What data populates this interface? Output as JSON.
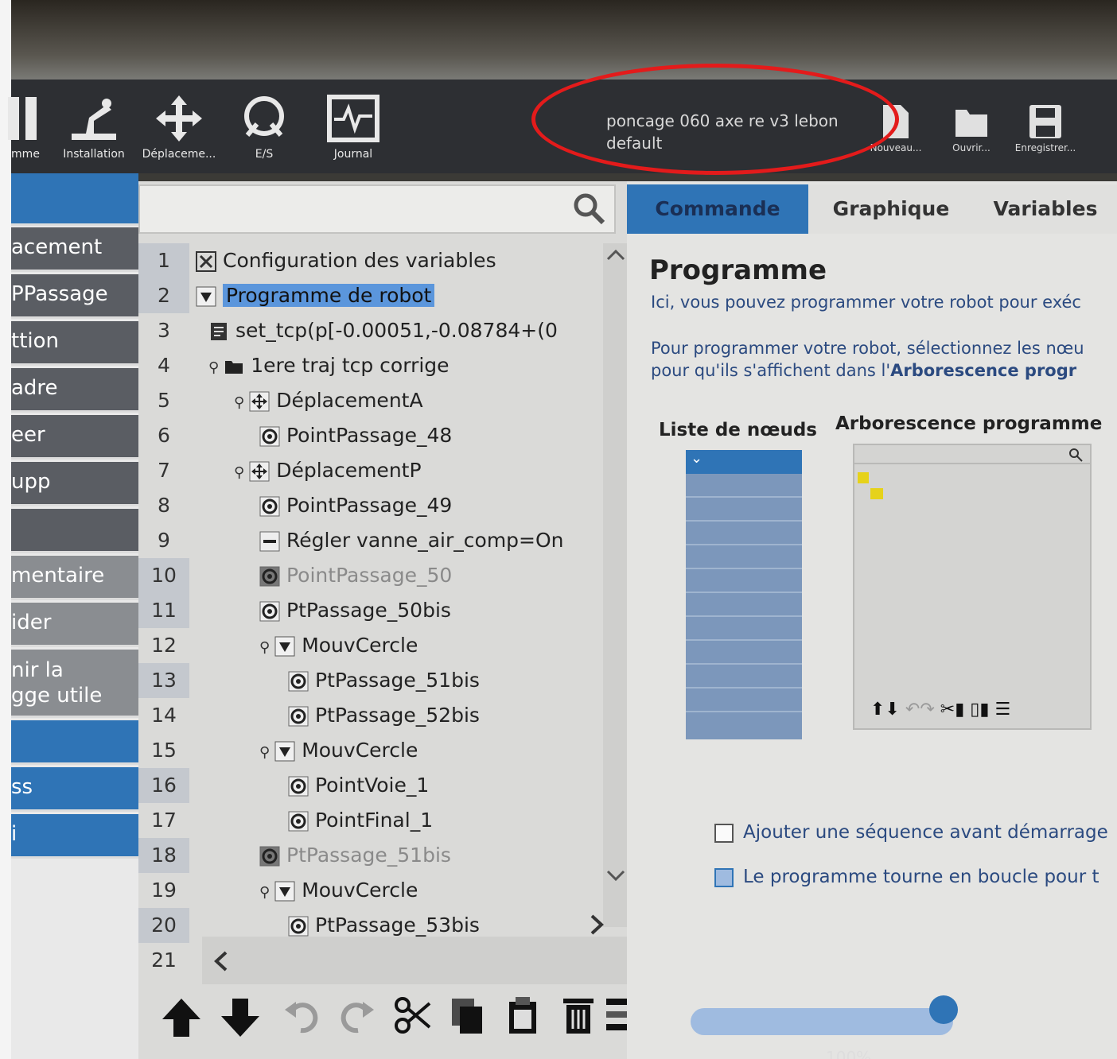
{
  "header": {
    "tools": [
      {
        "label": "mme",
        "icon": "program-icon"
      },
      {
        "label": "Installation",
        "icon": "robot-arm-icon"
      },
      {
        "label": "Déplaceme...",
        "icon": "move-arrows-icon"
      },
      {
        "label": "E/S",
        "icon": "io-icon"
      },
      {
        "label": "Journal",
        "icon": "log-icon"
      }
    ],
    "program_name": "poncage 060 axe re v3 lebon",
    "installation_name": "default",
    "file_buttons": [
      {
        "label": "Nouveau...",
        "icon": "new-file-icon"
      },
      {
        "label": "Ouvrir...",
        "icon": "open-folder-icon"
      },
      {
        "label": "Enregistrer...",
        "icon": "save-icon"
      }
    ]
  },
  "sidebar": {
    "items": [
      "acement",
      "PPassage",
      "ttion",
      "adre",
      "eer",
      "upp",
      "",
      "mentaire",
      "ider",
      "nir la",
      "gge utile",
      "",
      "ss",
      "i"
    ],
    "item_2_line": "gge utile"
  },
  "tree": {
    "line_numbers": [
      "1",
      "2",
      "3",
      "4",
      "5",
      "6",
      "7",
      "8",
      "9",
      "10",
      "11",
      "12",
      "13",
      "14",
      "15",
      "16",
      "17",
      "18",
      "19",
      "20",
      "21"
    ],
    "nodes": [
      {
        "text": "Configuration des variables",
        "icon": "variables-icon"
      },
      {
        "text": "Programme de robot",
        "icon": "collapse-icon"
      },
      {
        "text": "set_tcp(p[-0.00051,-0.08784+(0",
        "icon": "script-icon"
      },
      {
        "text": "1ere traj tcp corrige",
        "icon": "folder-icon"
      },
      {
        "text": "DéplacementA",
        "icon": "move-icon"
      },
      {
        "text": "PointPassage_48",
        "icon": "waypoint-icon"
      },
      {
        "text": "DéplacementP",
        "icon": "move-icon"
      },
      {
        "text": "PointPassage_49",
        "icon": "waypoint-icon"
      },
      {
        "text": "Régler vanne_air_comp=On",
        "icon": "set-icon"
      },
      {
        "text": "PointPassage_50",
        "icon": "waypoint-icon"
      },
      {
        "text": "PtPassage_50bis",
        "icon": "waypoint-icon"
      },
      {
        "text": "MouvCercle",
        "icon": "collapse-icon"
      },
      {
        "text": "PtPassage_51bis",
        "icon": "waypoint-icon"
      },
      {
        "text": "PtPassage_52bis",
        "icon": "waypoint-icon"
      },
      {
        "text": "MouvCercle",
        "icon": "collapse-icon"
      },
      {
        "text": "PointVoie_1",
        "icon": "waypoint-icon"
      },
      {
        "text": "PointFinal_1",
        "icon": "waypoint-icon"
      },
      {
        "text": "PtPassage_51bis",
        "icon": "waypoint-icon"
      },
      {
        "text": "MouvCercle",
        "icon": "collapse-icon"
      },
      {
        "text": "PtPassage_53bis",
        "icon": "waypoint-icon"
      }
    ]
  },
  "right": {
    "tabs": [
      "Commande",
      "Graphique",
      "Variables"
    ],
    "title": "Programme",
    "desc1": "Ici, vous pouvez programmer votre robot pour exéc",
    "desc2a": "Pour programmer votre robot, sélectionnez les nœu",
    "desc2b": "pour qu'ils s'affichent dans l'",
    "desc2bold": "Arborescence progr",
    "nodes_label": "Liste de nœuds",
    "tree_label": "Arborescence programme",
    "check1": "Ajouter une séquence avant démarrage",
    "check2": "Le programme tourne en boucle pour t",
    "speed_label": "100%"
  },
  "colors": {
    "accent": "#2f74b6",
    "highlight": "#e31b1b",
    "toolbar": "#2d2f33"
  }
}
